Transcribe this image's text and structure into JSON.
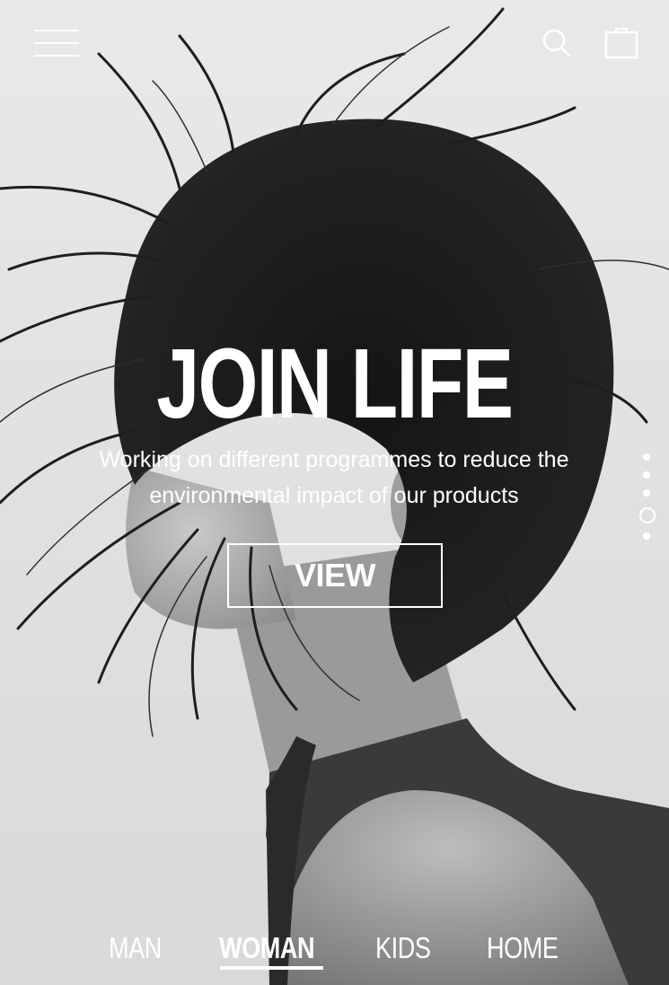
{
  "header": {
    "menu_icon": "hamburger-menu-icon",
    "search_icon": "search-icon",
    "bag_icon": "shopping-bag-icon"
  },
  "hero": {
    "title": "JOIN LIFE",
    "subtitle": "Working on different programmes to reduce the environmental impact of our products",
    "cta_label": "VIEW"
  },
  "pager": {
    "total": 5,
    "active_index": 4
  },
  "categories": [
    {
      "label": "MAN",
      "selected": false
    },
    {
      "label": "WOMAN",
      "selected": true
    },
    {
      "label": "KIDS",
      "selected": false
    },
    {
      "label": "HOME",
      "selected": false
    }
  ],
  "colors": {
    "foreground": "#ffffff",
    "background": "#e2e2e2"
  }
}
